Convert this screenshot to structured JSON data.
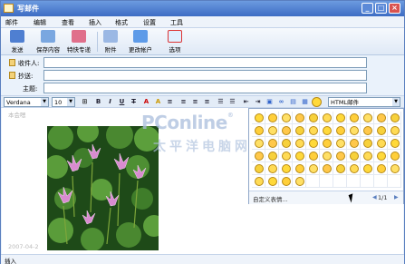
{
  "window": {
    "title": "写邮件"
  },
  "menu": [
    "邮件",
    "编辑",
    "查看",
    "插入",
    "格式",
    "设置",
    "工具"
  ],
  "toolbar": {
    "send": "发送",
    "save": "保存内容",
    "express": "特快专递",
    "attach": "附件",
    "change_account": "更改帐户",
    "options": "选项"
  },
  "fields": {
    "to_label": "收件人:",
    "cc_label": "抄送:",
    "subject_label": "主题:",
    "to_value": "",
    "cc_value": "",
    "subject_value": ""
  },
  "format": {
    "font": "Verdana",
    "size": "10",
    "mode": "HTML邮件"
  },
  "editor": {
    "placeholder": "本会嗯",
    "date": "2007-04-2"
  },
  "watermark": {
    "brand": "PConline",
    "reg": "®",
    "cn": "太平洋电脑网"
  },
  "emoticons": {
    "custom_label": "自定义表情...",
    "page": "1/1"
  },
  "status": {
    "text": "插入"
  }
}
